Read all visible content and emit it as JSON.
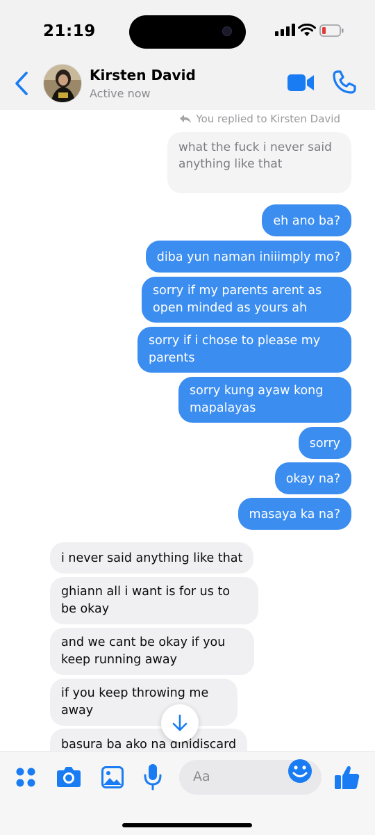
{
  "status_bar": {
    "time": "21:19",
    "battery_color": "#e23b3b"
  },
  "header": {
    "contact_name": "Kirsten David",
    "status": "Active now",
    "icons": [
      "back-chevron-icon",
      "video-call-icon",
      "phone-call-icon"
    ],
    "accent_color": "#1a7cf2"
  },
  "reply": {
    "note": "You replied to Kirsten David",
    "quoted_text": "what the fuck i never said anything like that"
  },
  "messages_out": [
    "eh ano ba?",
    "diba yun naman iniiimply mo?",
    "sorry if my parents arent as open minded as yours ah",
    "sorry if i chose to please my parents",
    "sorry kung ayaw kong mapalayas",
    "sorry",
    "okay na?",
    "masaya ka na?"
  ],
  "messages_in": [
    "i never said anything like that",
    "ghiann all i want is for us to be okay",
    "and we cant be okay if you keep running away",
    "if you keep throwing me away",
    "basura ba ako na dinidiscard"
  ],
  "composer": {
    "placeholder": "Aa",
    "icons": [
      "menu-dots-icon",
      "camera-icon",
      "gallery-icon",
      "microphone-icon",
      "emoji-icon",
      "thumbs-up-icon"
    ]
  },
  "colors": {
    "outgoing_bubble": "#3b8df0",
    "incoming_bubble": "#f0f0f2"
  }
}
